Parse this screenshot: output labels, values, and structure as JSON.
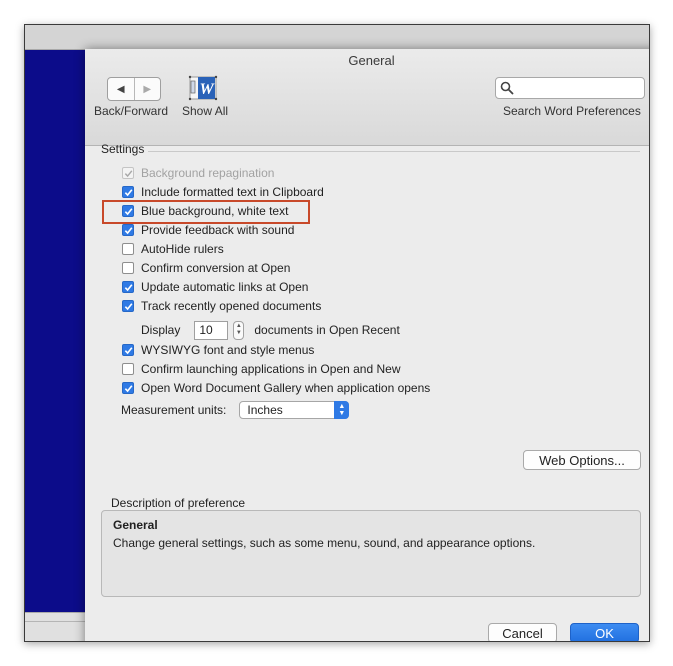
{
  "window": {
    "title": "General"
  },
  "toolbar": {
    "back_forward_label": "Back/Forward",
    "show_all_label": "Show All",
    "search_placeholder": "",
    "search_caption": "Search Word Preferences"
  },
  "settings": {
    "section_label": "Settings",
    "options": [
      {
        "label": "Background repagination",
        "checked": true,
        "enabled": false
      },
      {
        "label": "Include formatted text in Clipboard",
        "checked": true,
        "enabled": true
      },
      {
        "label": "Blue background, white text",
        "checked": true,
        "enabled": true,
        "highlighted": true
      },
      {
        "label": "Provide feedback with sound",
        "checked": true,
        "enabled": true
      },
      {
        "label": "AutoHide rulers",
        "checked": false,
        "enabled": true
      },
      {
        "label": "Confirm conversion at Open",
        "checked": false,
        "enabled": true
      },
      {
        "label": "Update automatic links at Open",
        "checked": true,
        "enabled": true
      },
      {
        "label": "Track recently opened documents",
        "checked": true,
        "enabled": true
      },
      {
        "label": "WYSIWYG font and style menus",
        "checked": true,
        "enabled": true
      },
      {
        "label": "Confirm launching applications in Open and New",
        "checked": false,
        "enabled": true
      },
      {
        "label": "Open Word Document Gallery when application opens",
        "checked": true,
        "enabled": true
      }
    ],
    "recent": {
      "display_label": "Display",
      "count": "10",
      "suffix": "documents in Open Recent"
    },
    "units": {
      "label": "Measurement units:",
      "value": "Inches"
    }
  },
  "buttons": {
    "web_options": "Web Options...",
    "cancel": "Cancel",
    "ok": "OK"
  },
  "description": {
    "label": "Description of preference",
    "title": "General",
    "text": "Change general settings, such as some menu, sound, and appearance options."
  },
  "colors": {
    "accent": "#2f7ae5",
    "highlight_border": "#c8492a",
    "desktop": "#0c0c8a"
  }
}
